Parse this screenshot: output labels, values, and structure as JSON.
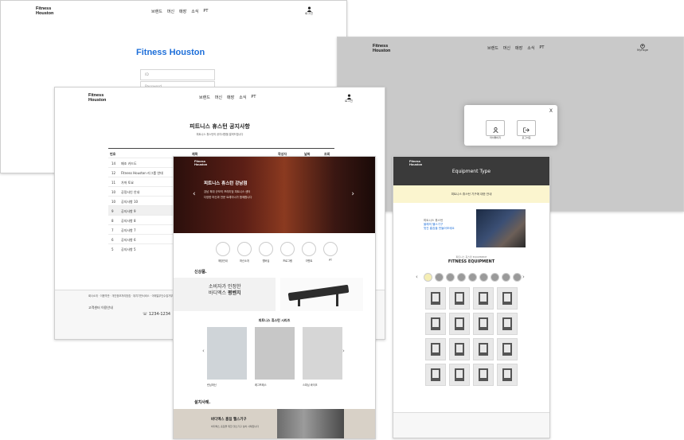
{
  "brand": {
    "logo_line1": "Fitness",
    "logo_line2": "Houston",
    "accent": "#1e6fd9"
  },
  "nav": [
    "브랜드",
    "머신",
    "매장",
    "소식",
    "PT"
  ],
  "user_label": "로그인",
  "login_page": {
    "title": "Fitness Houston",
    "id_placeholder": "ID",
    "pw_placeholder": "Password"
  },
  "modal_page": {
    "mypage_label": "MyPage",
    "close": "X",
    "btn_mypage": "마이페이지",
    "btn_logout": "로그아웃"
  },
  "notice_page": {
    "title": "피트니스 휴스턴 공지사항",
    "subtitle": "피트니스 휴스턴의 공지사항을 알려드립니다",
    "columns": [
      "번호",
      "제목",
      "작성자",
      "날짜",
      "조회"
    ],
    "rows": [
      {
        "no": "14",
        "title": "패조 카드도"
      },
      {
        "no": "12",
        "title": "Fitness Houston 리그룹 연대"
      },
      {
        "no": "11",
        "title": "가까 토요"
      },
      {
        "no": "10",
        "title": "공정사인 안내"
      },
      {
        "no": "10",
        "title": "공지사항 10"
      },
      {
        "no": "9",
        "title": "공지사항 9"
      },
      {
        "no": "8",
        "title": "공지사항 8"
      },
      {
        "no": "7",
        "title": "공지사항 7"
      },
      {
        "no": "6",
        "title": "공지사항 6"
      },
      {
        "no": "5",
        "title": "공지사항 5"
      }
    ],
    "footer_links": "회사소개 · 이용약관 · 개인정보처리방침 · 위치기반서비스 · 이메일무단수집거부",
    "cs_title": "고객센터 이용안내",
    "phone": "1234-1234"
  },
  "home_page": {
    "hero_title": "피트니스 휴스턴 강남점",
    "hero_text": "강남 최대 규모의 프리미엄 피트니스 센터",
    "hero_sub": "다양한 머신과 전문 트레이너가 함께합니다",
    "quick_menu": [
      "매장안내",
      "머신소개",
      "멤버십",
      "프로그램",
      "이벤트",
      "PT"
    ],
    "new_title": "신상품.",
    "product_caption1": "소비자가 인정한",
    "product_caption2": "바디엑스 ",
    "product_caption_strong": "평벤치",
    "series_title": "피트니스 휴스턴 시리즈",
    "products": [
      "런닝머신",
      "레그프레스",
      "스피닝 바이크"
    ],
    "install_title": "설치사례.",
    "install_heading": "바디엑스 홈짐 헬스기구",
    "install_text": "바디엑스 홈짐을 위한 헬스기구 설치 사례입니다"
  },
  "equip_page": {
    "banner_title": "Equipment Type",
    "notice_text": "피트니스 휴스턴 기구에 대한 안내",
    "promo_l1": "피트니스 휴스턴",
    "promo_l2": "올해의 헬스기구",
    "promo_l3": "멋진 홈짐을 만들어보세요",
    "section_label": "FITNESS EQUIPMENT",
    "section_sub": "피트니스 휴스턴 EQUIPMENT"
  }
}
